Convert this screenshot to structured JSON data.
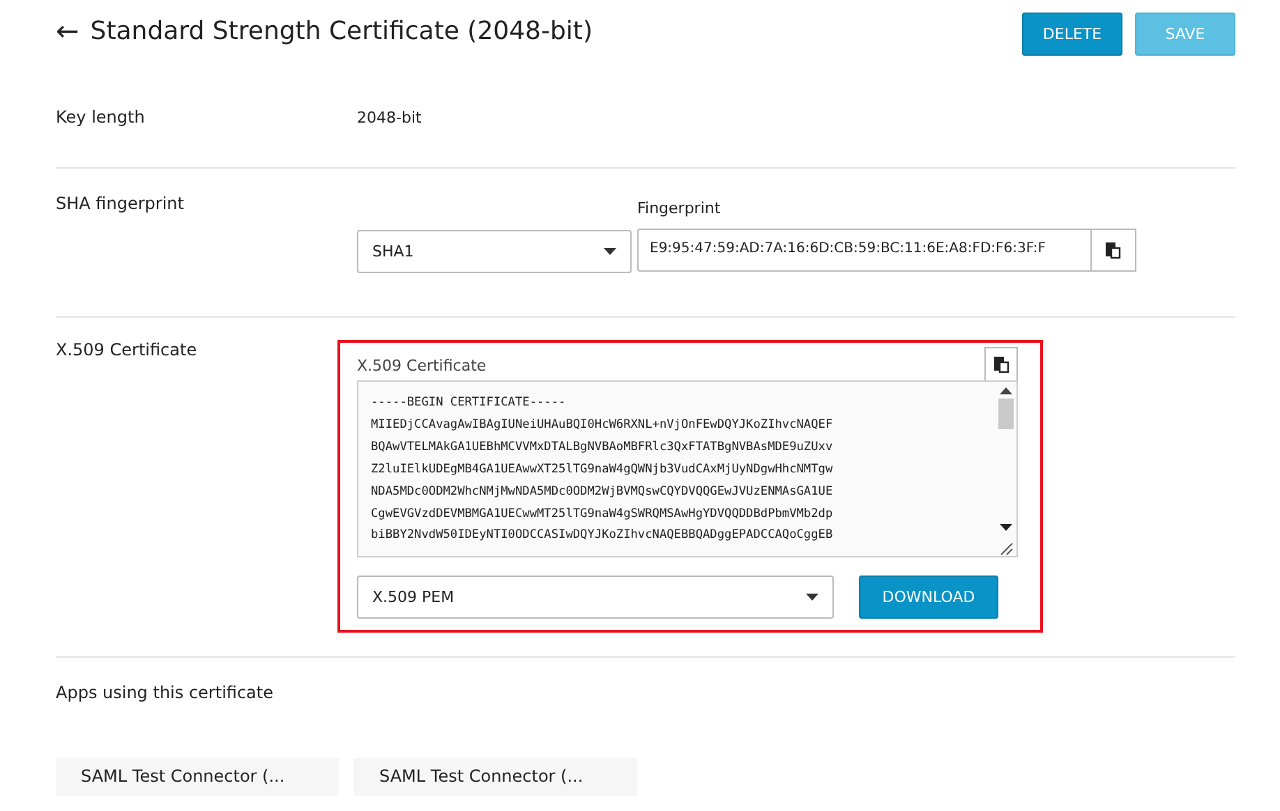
{
  "header": {
    "back_icon": "←",
    "title": "Standard Strength Certificate (2048-bit)",
    "buttons": [
      {
        "label": "DELETE",
        "disabled": false
      },
      {
        "label": "SAVE",
        "disabled": true
      }
    ]
  },
  "key_length": {
    "label": "Key length",
    "value": "2048-bit"
  },
  "sha_fingerprint": {
    "label": "SHA fingerprint",
    "algorithm": "SHA1",
    "field_label": "Fingerprint",
    "value": "E9:95:47:59:AD:7A:16:6D:CB:59:BC:11:6E:A8:FD:F6:3F:F"
  },
  "certificate": {
    "label": "X.509 Certificate",
    "field_label": "X.509 Certificate",
    "highlighted": true,
    "lines": [
      "-----BEGIN CERTIFICATE-----",
      "MIIEDjCCAvagAwIBAgIUNeiUHAuBQI0HcW6RXNL+nVjOnFEwDQYJKoZIhvcNAQEF",
      "BQAwVTELMAkGA1UEBhMCVVMxDTALBgNVBAoMBFRlc3QxFTATBgNVBAsMDE9uZUxv",
      "Z2luIElkUDEgMB4GA1UEAwwXT25lTG9naW4gQWNjb3VudCAxMjUyNDgwHhcNMTgw",
      "NDA5MDc0ODM2WhcNMjMwNDA5MDc0ODM2WjBVMQswCQYDVQQGEwJVUzENMAsGA1UE",
      "CgwEVGVzdDEVMBMGA1UECwwMT25lTG9naW4gSWRQMSAwHgYDVQQDDBdPbmVMb2dp",
      "biBBY2NvdW50IDEyNTI0ODCCASIwDQYJKoZIhvcNAQEBBQADggEPADCCAQoCggEB"
    ],
    "format": "X.509 PEM",
    "download": "DOWNLOAD"
  },
  "apps": {
    "label": "Apps using this certificate",
    "items": [
      "SAML Test Connector (...",
      "SAML Test Connector (..."
    ]
  }
}
